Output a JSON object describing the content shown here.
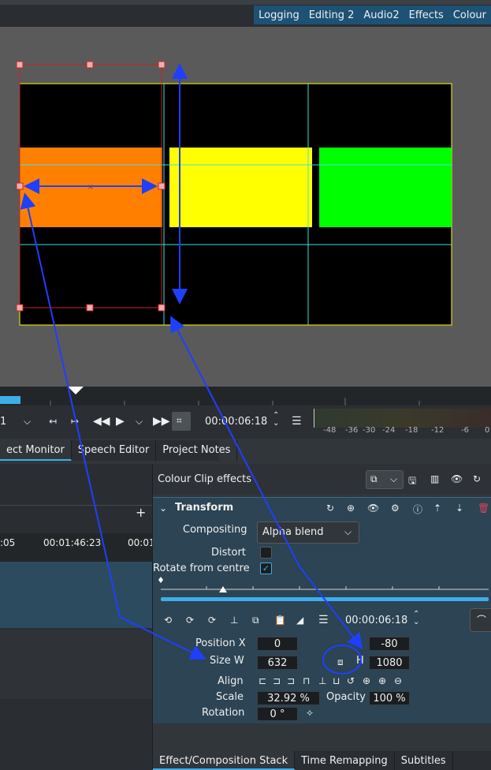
{
  "layouts": [
    "Logging",
    "Editing 2",
    "Audio2",
    "Effects",
    "Colour"
  ],
  "transport": {
    "zoom": "1",
    "timecode": "00:00:06:18",
    "meter_labels": [
      "-48",
      "-36",
      "-30",
      "-24",
      "-18",
      "-12",
      "-6",
      "0"
    ]
  },
  "tabs_left": [
    "ect Monitor",
    "Speech Editor",
    "Project Notes"
  ],
  "timeline": {
    "ticks": [
      ":05",
      "00:01:46:23",
      "00:01"
    ]
  },
  "effects": {
    "header": "Colour Clip effects",
    "transform_title": "Transform",
    "compositing_label": "Compositing",
    "compositing_value": "Alpha blend",
    "distort_label": "Distort",
    "rotate_label": "Rotate from centre",
    "timecode": "00:00:06:18",
    "position_label": "Position X",
    "position_x": "0",
    "position_y": "-80",
    "size_label": "Size W",
    "size_w": "632",
    "size_h_label": "H",
    "size_h": "1080",
    "align_label": "Align",
    "scale_label": "Scale",
    "scale_value": "32.92 %",
    "opacity_label": "Opacity",
    "opacity_value": "100 %",
    "rotation_label": "Rotation",
    "rotation_value": "0 °"
  },
  "bottom_tabs": [
    "Effect/Composition Stack",
    "Time Remapping",
    "Subtitles"
  ],
  "colors": {
    "accent": "#3daee9",
    "orange": "#ff8000",
    "yellow": "#ffff00",
    "green": "#00ff00",
    "annotation": "#1f3fff",
    "selection": "#cc2222"
  }
}
